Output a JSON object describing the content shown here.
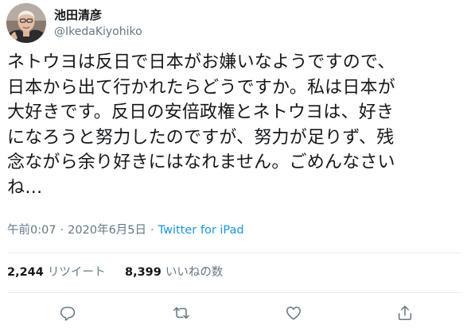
{
  "user": {
    "display_name": "池田清彦",
    "handle": "@IkedaKiyohiko",
    "avatar_icon": "person-avatar-icon"
  },
  "tweet": {
    "lines": [
      "ネトウヨは反日で日本がお嫌いなようですので、",
      "日本から出て行かれたらどうですか。私は日本が",
      "大好きです。反日の安倍政権とネトウヨは、好き",
      "になろうと努力したのですが、努力が足りず、残",
      "念ながら余り好きにはなれません。ごめんなさい",
      "ね…"
    ]
  },
  "meta": {
    "time": "午前0:07",
    "separator": "·",
    "date": "2020年6月5日",
    "source": "Twitter for iPad"
  },
  "stats": {
    "retweets_count": "2,244",
    "retweets_label": "リツイート",
    "likes_count": "8,399",
    "likes_label": "いいねの数"
  },
  "actions": [
    {
      "icon": "reply-icon"
    },
    {
      "icon": "retweet-icon"
    },
    {
      "icon": "like-icon"
    },
    {
      "icon": "share-icon"
    }
  ],
  "colors": {
    "text": "#14171a",
    "secondary": "#657786",
    "link": "#1b95e0",
    "divider": "#e6ecf0"
  }
}
